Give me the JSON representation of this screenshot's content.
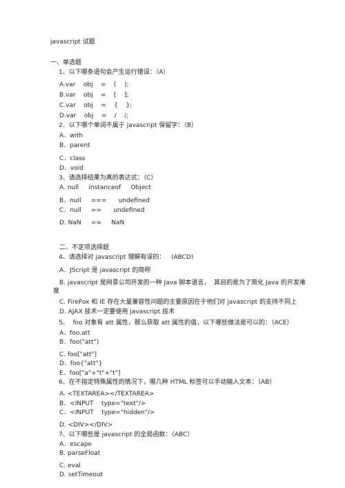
{
  "title": "javascript 试题",
  "sections": [
    {
      "heading": "一、单选题"
    },
    {
      "heading": "二、不定项选择题"
    }
  ],
  "questions": [
    {
      "text": "1、以下哪条语句会产生运行错误：（A）",
      "options": [
        "A.var    obj    =    (    );",
        "B.var    obj    =    [    ];",
        "C.var    obj    =    {    };",
        "D.var    obj    =    /    /;"
      ]
    },
    {
      "text": "2、以下哪个单词不属于 javascript 保留字：（B）",
      "options": [
        "A．with",
        "B．parent",
        "C．class",
        "D．void"
      ]
    },
    {
      "text": "3、请选择结果为真的表达式：（C）",
      "options": [
        "A. null     instanceof     Object",
        "B．null     ===      undefined",
        "C．null     ==      undefined",
        "D. NaN     ==     NaN"
      ]
    },
    {
      "text": "4、请选择对 javascript 理解有误的：   (ABCD)",
      "options": [
        "A．JScript 是 javascript 的简称",
        "B. javascript 是网景公司开发的一种 Java 脚本语言，  其目的是为了简化 Java 的开发难",
        "度",
        "C. FireFox 和 IE 存在大量兼容性问题的主要原因在于他们对 javascript 的支持不同上",
        "D. AJAX 技术一定要使用 javascript 技术"
      ]
    },
    {
      "text": "5、  foo 对象有 att 属性，那么获取 att 属性的值，以下哪些做法是可以的：（ACE）",
      "options": [
        "A．foo.att",
        "B．foo(\"att\")",
        "C. foo[\"att\"]",
        "D．foo{\"att\"}",
        "E．foo[\"a\"+\"t\"+\"t\"]"
      ]
    },
    {
      "text": "6、在不指定特殊属性的情况下，哪几种 HTML 标签可以手动输入文本：（AB）",
      "options": [
        "A. <TEXTAREA></TEXTAREA>",
        "B．<INPUT    type=\"text\"/>",
        "C．<INPUT    type=\"hidden\"/>",
        "D. <DIV></DIV>"
      ]
    },
    {
      "text": "7、以下哪些是 javascript 的全局函数：（ABC）",
      "options": [
        "A．escape",
        "B. parseFloat",
        "C. eval",
        "D. setTimeout"
      ]
    }
  ]
}
